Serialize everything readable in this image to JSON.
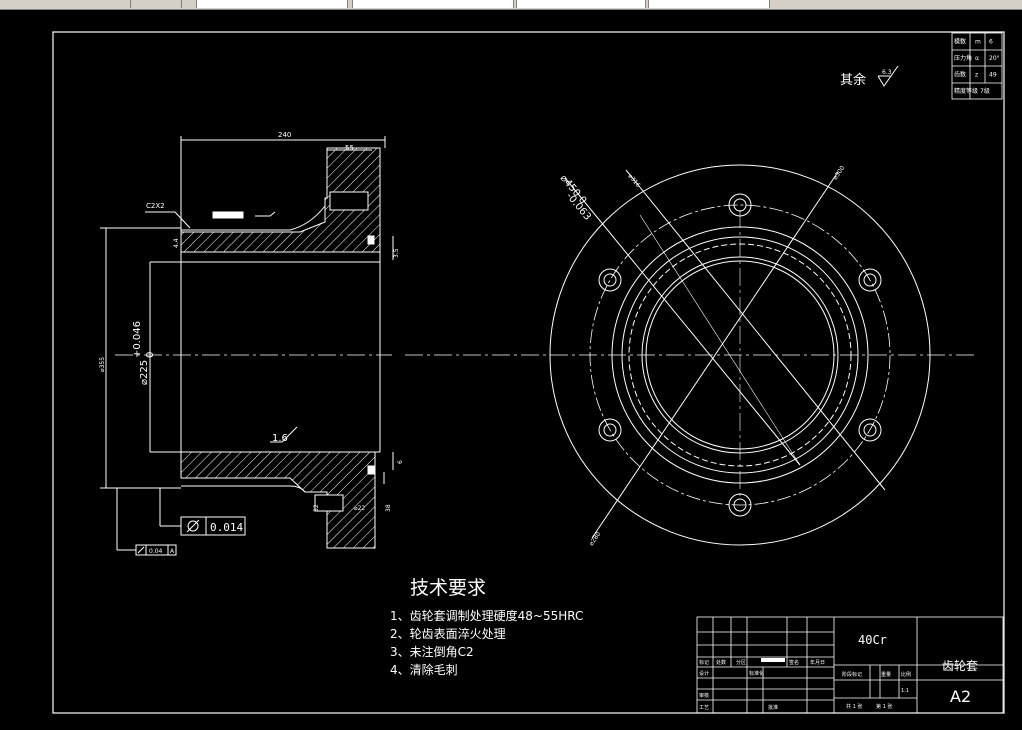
{
  "drawing": {
    "roughness_label": "其余",
    "roughness_value": "6.3",
    "tech_req": {
      "title": "技术要求",
      "items": [
        "1、齿轮套调制处理硬度48~55HRC",
        "2、轮齿表面淬火处理",
        "3、未注倒角C2",
        "4、清除毛刺"
      ]
    },
    "dims": {
      "length": "240",
      "flange_width": "55",
      "chamfer": "C2X2",
      "bore_main": "⌀225",
      "bore_tol_upper": "+0.046",
      "bore_tol_lower": "0",
      "outer_dia": "⌀355",
      "roughness_bore": "1.6",
      "flatness_value": "0.014",
      "runout_value": "0.04",
      "runout_datum": "A",
      "hole_depth_1": "32",
      "hole_depth_2": "38",
      "hole_dia": "⌀22",
      "step_1": "4.4",
      "step_2": "3.5",
      "step_3": "6",
      "bolt_circle": "⌀450  0",
      "bolt_circle_tol": "-0.063",
      "ref_dim_1": "⌀316",
      "ref_dim_2": "⌀300",
      "ref_dim_3": "⌀280"
    },
    "param_table": {
      "rows": [
        {
          "name": "模数",
          "sym": "m",
          "val": "6"
        },
        {
          "name": "压力角",
          "sym": "α",
          "val": "20°"
        },
        {
          "name": "齿数",
          "sym": "z",
          "val": "49"
        },
        {
          "name": "精度等级",
          "sym": "",
          "val": "7级"
        }
      ]
    },
    "title_block": {
      "material": "40Cr",
      "part_name": "齿轮套",
      "sheet_size": "A2",
      "labels": {
        "mark": "标记",
        "count": "处数",
        "zone": "分区",
        "doc_no": "更改文件号",
        "sign": "签名",
        "date": "年月日",
        "design": "设计",
        "std": "标准化",
        "check": "审核",
        "process": "工艺",
        "approve": "批准",
        "stage_mark": "阶段标记",
        "weight": "重量",
        "scale": "比例",
        "scale_val": "1:1",
        "sheets_total": "共 1 张",
        "sheet_no": "第 1 张"
      }
    }
  }
}
